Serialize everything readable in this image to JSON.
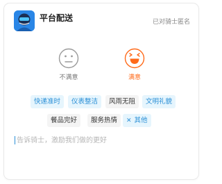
{
  "header": {
    "title": "平台配送",
    "anonymous_label": "已对骑士匿名"
  },
  "ratings": {
    "dissatisfied_label": "不满意",
    "satisfied_label": "满意",
    "selected": "满意"
  },
  "tags": {
    "row1": [
      {
        "label": "快递准时",
        "selected": true
      },
      {
        "label": "仪表整洁",
        "selected": true
      },
      {
        "label": "风雨无阻",
        "selected": false
      },
      {
        "label": "文明礼貌",
        "selected": true
      }
    ],
    "row2": [
      {
        "label": "餐品完好",
        "selected": false
      },
      {
        "label": "服务热情",
        "selected": false
      },
      {
        "label": "其他",
        "selected": true,
        "icon": "close-icon"
      }
    ]
  },
  "comment": {
    "placeholder": "告诉骑士，激励我们做的更好",
    "value": ""
  },
  "colors": {
    "accent_blue": "#2a8fd6",
    "selected_tag_bg": "#e6f5fd",
    "satisfied_orange": "#ff6a1a",
    "dissatisfied_gray": "#9a9a9a"
  }
}
